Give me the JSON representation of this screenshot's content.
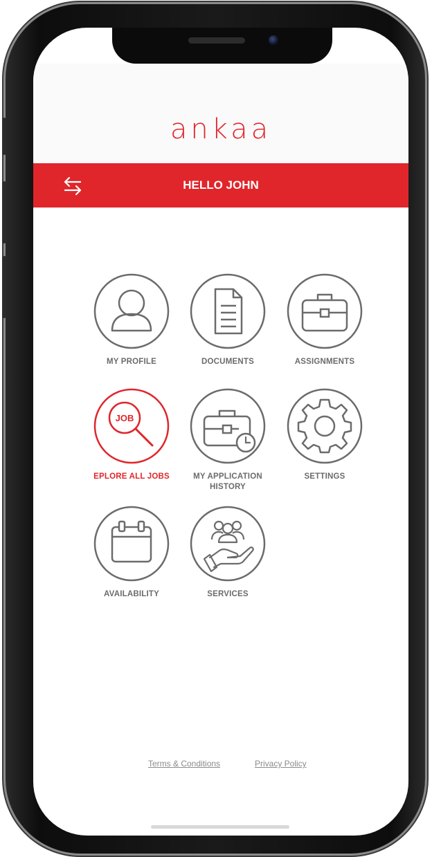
{
  "app": {
    "logo_text": "ankaa",
    "greeting": "HELLO JOHN"
  },
  "colors": {
    "accent": "#e0262b",
    "icon_gray": "#6b6b6b",
    "label_gray": "#6b6b6b"
  },
  "menu": [
    {
      "label": "MY  PROFILE",
      "icon": "user-icon",
      "active": false
    },
    {
      "label": "DOCUMENTS",
      "icon": "document-icon",
      "active": false
    },
    {
      "label": "ASSIGNMENTS",
      "icon": "briefcase-icon",
      "active": false
    },
    {
      "label": "EPLORE ALL JOBS",
      "icon": "job-search-icon",
      "icon_text": "JOB",
      "active": true
    },
    {
      "label": "MY APPLICATION HISTORY",
      "icon": "briefcase-history-icon",
      "active": false
    },
    {
      "label": "SETTINGS",
      "icon": "gear-icon",
      "active": false
    },
    {
      "label": "AVAILABILITY",
      "icon": "calendar-icon",
      "active": false
    },
    {
      "label": "SERVICES",
      "icon": "people-hand-icon",
      "active": false
    }
  ],
  "footer": {
    "terms": "Terms & Conditions",
    "privacy": "Privacy Policy "
  }
}
